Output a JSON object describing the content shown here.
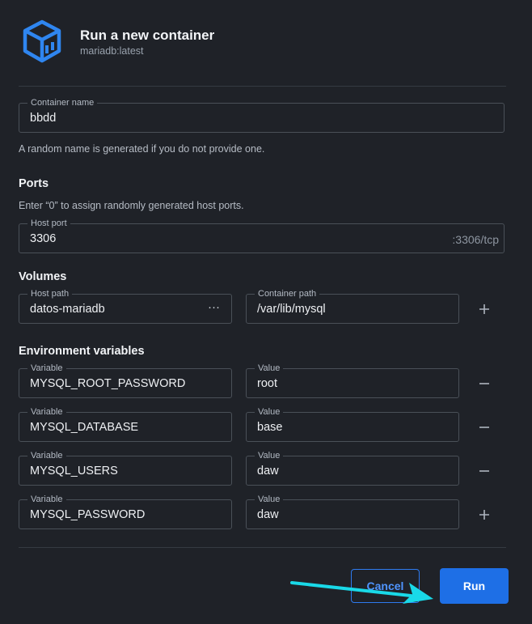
{
  "header": {
    "title": "Run a new container",
    "image": "mariadb:latest",
    "logo_icon": "container-cube-icon"
  },
  "container_name": {
    "label": "Container name",
    "value": "bbdd",
    "helper": "A random name is generated if you do not provide one."
  },
  "ports": {
    "heading": "Ports",
    "helper": "Enter “0” to assign randomly generated host ports.",
    "host_port_label": "Host port",
    "host_port_value": "3306",
    "container_port_suffix": ":3306/tcp"
  },
  "volumes": {
    "heading": "Volumes",
    "host_path_label": "Host path",
    "host_path_value": "datos-mariadb",
    "browse_label": "···",
    "container_path_label": "Container path",
    "container_path_value": "/var/lib/mysql",
    "add_icon": "plus-icon"
  },
  "env": {
    "heading": "Environment variables",
    "rows": [
      {
        "var_label": "Variable",
        "var_value": "MYSQL_ROOT_PASSWORD",
        "val_label": "Value",
        "val_value": "root",
        "action": "minus-icon"
      },
      {
        "var_label": "Variable",
        "var_value": "MYSQL_DATABASE",
        "val_label": "Value",
        "val_value": "base",
        "action": "minus-icon"
      },
      {
        "var_label": "Variable",
        "var_value": "MYSQL_USERS",
        "val_label": "Value",
        "val_value": "daw",
        "action": "minus-icon"
      },
      {
        "var_label": "Variable",
        "var_value": "MYSQL_PASSWORD",
        "val_label": "Value",
        "val_value": "daw",
        "action": "plus-icon"
      }
    ]
  },
  "footer": {
    "cancel_label": "Cancel",
    "run_label": "Run"
  },
  "colors": {
    "background": "#1f2228",
    "accent": "#1e6fe6",
    "annotation_arrow": "#19d9e8"
  }
}
